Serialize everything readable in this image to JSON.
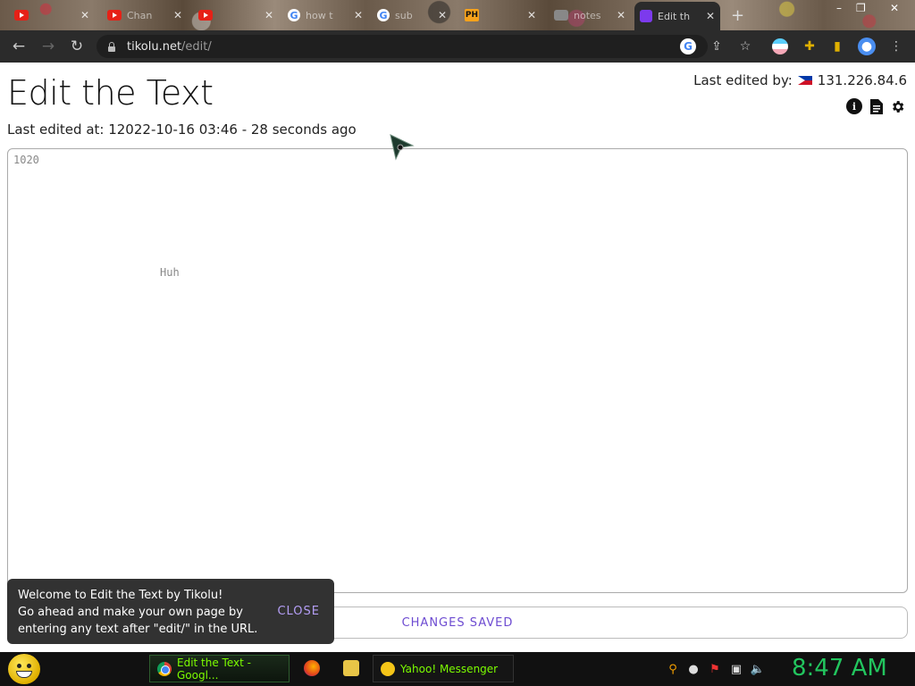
{
  "browser": {
    "tabs": [
      {
        "label": "",
        "favicon": "youtube-icon"
      },
      {
        "label": "Chan",
        "favicon": "youtube-icon"
      },
      {
        "label": "",
        "favicon": "youtube-icon"
      },
      {
        "label": "how t",
        "favicon": "google-icon"
      },
      {
        "label": "sub",
        "favicon": "google-icon"
      },
      {
        "label": "",
        "favicon": "ph-icon"
      },
      {
        "label": "notes",
        "favicon": "generic-icon"
      },
      {
        "label": "Edit th",
        "favicon": "edit-icon",
        "active": true
      }
    ],
    "url_host": "tikolu.net",
    "url_path": "/edit/"
  },
  "page": {
    "title": "Edit the Text",
    "last_edited_at": "Last edited at: 12022-10-16  03:46 - 28 seconds ago",
    "last_edited_by_label": "Last edited by:",
    "last_edited_by_ip": "131.226.84.6",
    "editor_lines": [
      "1020",
      "Huh"
    ],
    "status": "CHANGES SAVED"
  },
  "toast": {
    "line1": "Welcome to Edit the Text by Tikolu!",
    "line2": "Go ahead and make your own page by",
    "line3": "entering any text after \"edit/\" in the URL.",
    "close_label": "CLOSE"
  },
  "taskbar": {
    "chrome_task": "Edit the Text - Googl...",
    "yahoo_task": "Yahoo! Messenger",
    "clock": "8:47 AM"
  },
  "colors": {
    "accent": "#6d4bd1",
    "toast_bg": "#323232",
    "clock": "#22c55e"
  }
}
